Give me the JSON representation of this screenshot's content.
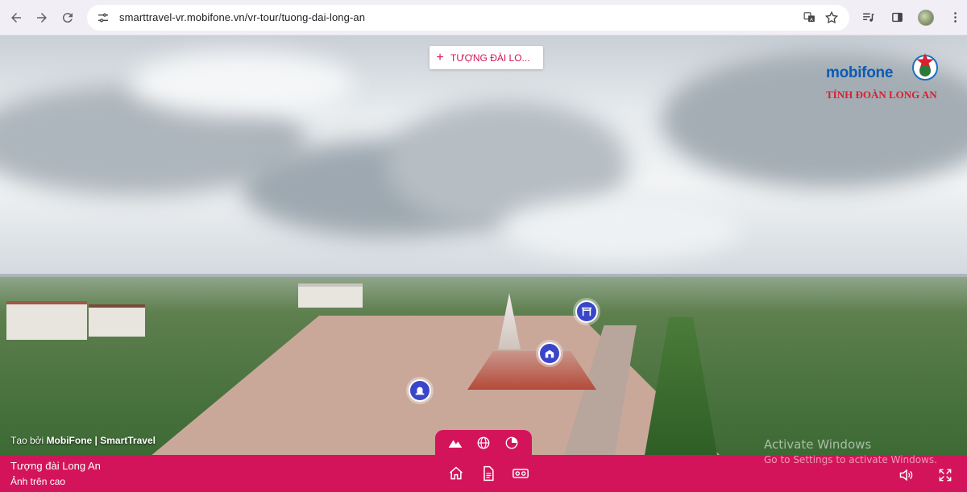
{
  "browser": {
    "url": "smarttravel-vr.mobifone.vn/vr-tour/tuong-dai-long-an"
  },
  "tour": {
    "scene_pill_label": "TƯỢNG ĐÀI LO...",
    "logo_brand": "mobifone",
    "logo_subtitle": "TỈNH ĐOÀN LONG AN",
    "credit_prefix": "Tạo bởi ",
    "credit_brand": "MobiFone | SmartTravel",
    "place_title": "Tượng đài Long An",
    "place_subtitle": "Ảnh trên cao",
    "mode_tabs": [
      "aerial-mode-icon",
      "globe-mode-icon",
      "pano-mode-icon"
    ],
    "bottom_icons": [
      "home-icon",
      "document-icon",
      "vr-headset-icon"
    ],
    "accent_color": "#d4145a",
    "hotspot_color": "#3a46c9"
  },
  "watermark": {
    "title": "Activate Windows",
    "subtitle": "Go to Settings to activate Windows."
  }
}
